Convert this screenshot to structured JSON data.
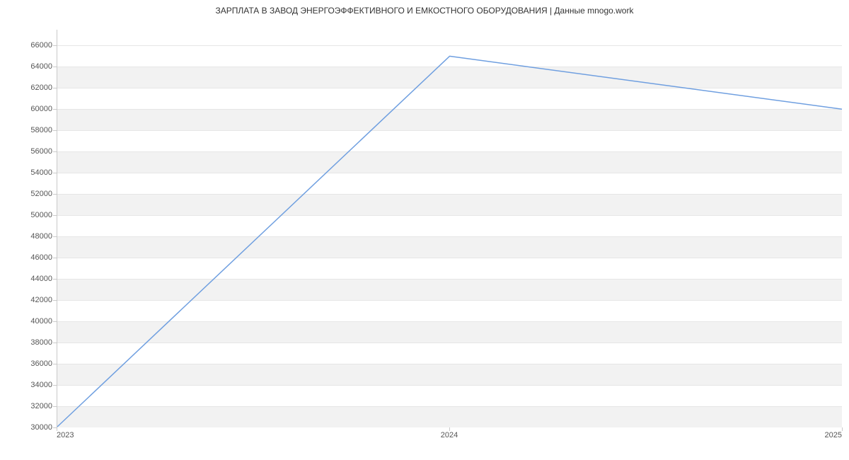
{
  "chart_data": {
    "type": "line",
    "title": "ЗАРПЛАТА В ЗАВОД ЭНЕРГОЭФФЕКТИВНОГО И ЕМКОСТНОГО ОБОРУДОВАНИЯ | Данные mnogo.work",
    "x": [
      2023,
      2024,
      2025
    ],
    "values": [
      30000,
      65000,
      60000
    ],
    "xlabel": "",
    "ylabel": "",
    "xlim": [
      2023,
      2025
    ],
    "ylim": [
      30000,
      67500
    ],
    "y_ticks": [
      30000,
      32000,
      34000,
      36000,
      38000,
      40000,
      42000,
      44000,
      46000,
      48000,
      50000,
      52000,
      54000,
      56000,
      58000,
      60000,
      62000,
      64000,
      66000
    ],
    "x_ticks": [
      2023,
      2024,
      2025
    ],
    "line_color": "#6f9fe0"
  }
}
